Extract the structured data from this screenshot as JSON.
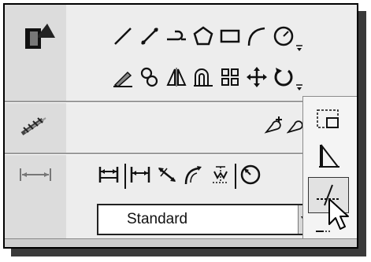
{
  "panel": {
    "draw_row_icons": [
      "line-icon",
      "construction-line-icon",
      "polyline-icon",
      "polygon-icon",
      "rectangle-icon",
      "arc-icon",
      "circle-icon"
    ],
    "modify_row_icons": [
      "erase-icon",
      "copy-icon",
      "mirror-icon",
      "offset-icon",
      "array-icon",
      "move-icon",
      "rotate-icon"
    ],
    "dimension_row_icons": [
      "dim-linear-icon",
      "dim-aligned-icon",
      "dim-angular-icon",
      "dim-arc-icon",
      "dim-ordinate-icon",
      "dim-radius-icon"
    ]
  },
  "dimstyle": {
    "selected": "Standard"
  },
  "flyout": {
    "items": [
      "rectangle-select-icon",
      "trim-icon",
      "extend-icon",
      "lengthen-icon"
    ]
  }
}
